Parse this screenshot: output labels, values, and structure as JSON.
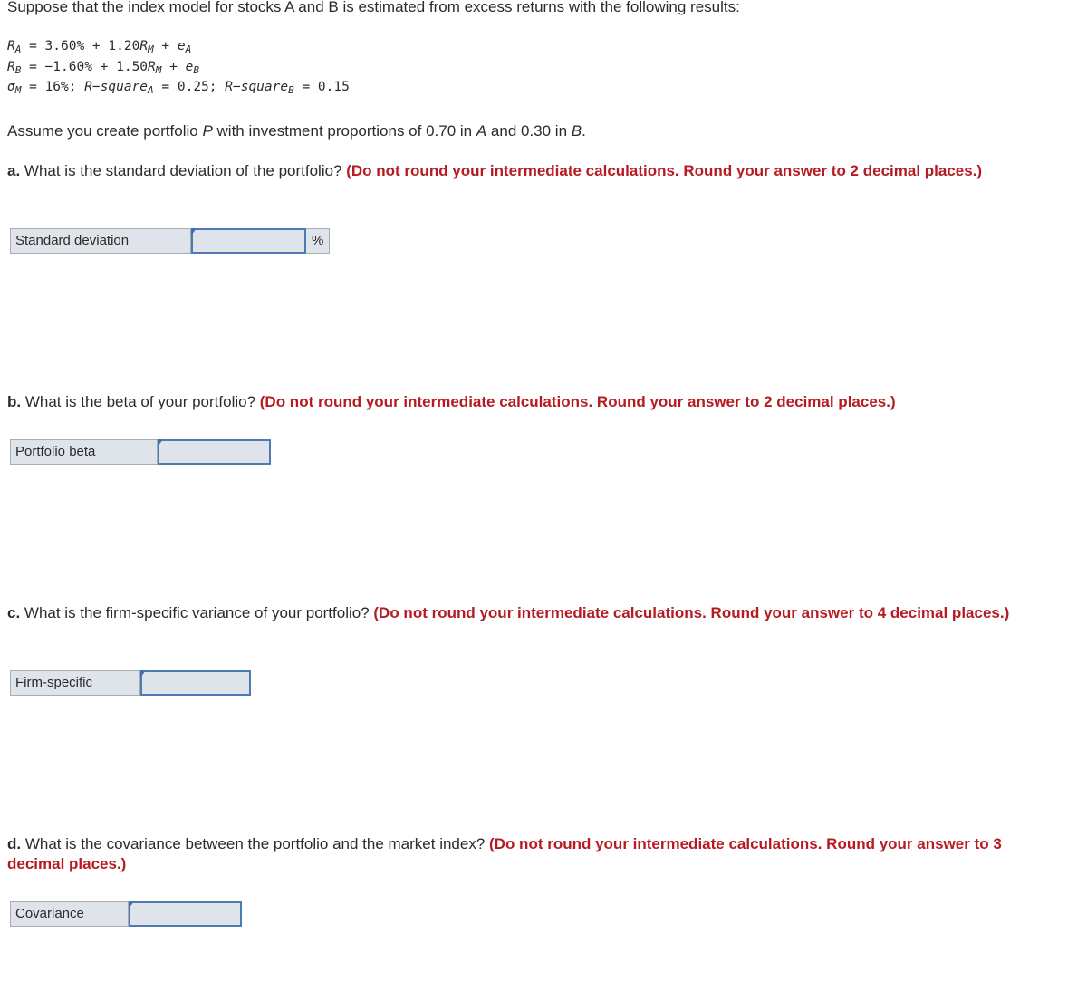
{
  "intro": "Suppose that the index model for stocks A and B is estimated from excess returns with the following results:",
  "equations": {
    "line1": {
      "lhs": "R",
      "lhs_sub": "A",
      "eq": " = 3.60% + 1.20",
      "rm": "R",
      "rm_sub": "M",
      "plus": " + ",
      "err": "e",
      "err_sub": "A"
    },
    "line2": {
      "lhs": "R",
      "lhs_sub": "B",
      "eq": " = −1.60% + 1.50",
      "rm": "R",
      "rm_sub": "M",
      "plus": " + ",
      "err": "e",
      "err_sub": "B"
    },
    "line3": {
      "sigma": "σ",
      "sigma_sub": "M",
      "part1": " = 16%; ",
      "rsqA": "R−square",
      "rsqA_sub": "A",
      "part2": " = 0.25; ",
      "rsqB": "R−square",
      "rsqB_sub": "B",
      "part3": " = 0.15"
    }
  },
  "assume": {
    "t1": "Assume you create portfolio ",
    "p": "P",
    "t2": " with investment proportions of 0.70 in ",
    "a": "A",
    "t3": " and 0.30 in ",
    "b": "B",
    "t4": "."
  },
  "questions": [
    {
      "letter": "a.",
      "text": " What is the standard deviation of the portfolio? ",
      "instruction": "(Do not round your intermediate calculations. Round your answer to 2 decimal places.)",
      "label": "Standard deviation",
      "value": "",
      "unit": "%"
    },
    {
      "letter": "b.",
      "text": " What is the beta of your portfolio? ",
      "instruction": "(Do not round your intermediate calculations. Round your answer to 2 decimal places.)",
      "label": "Portfolio beta",
      "value": ""
    },
    {
      "letter": "c.",
      "text": " What is the firm-specific variance of your portfolio? ",
      "instruction": "(Do not round your intermediate calculations. Round your answer to 4 decimal places.)",
      "label": "Firm-specific",
      "value": ""
    },
    {
      "letter": "d.",
      "text": " What is the covariance between the portfolio and the market index? ",
      "instruction": "(Do not round your intermediate calculations. Round your answer to 3 decimal places.)",
      "label": "Covariance",
      "value": ""
    }
  ]
}
